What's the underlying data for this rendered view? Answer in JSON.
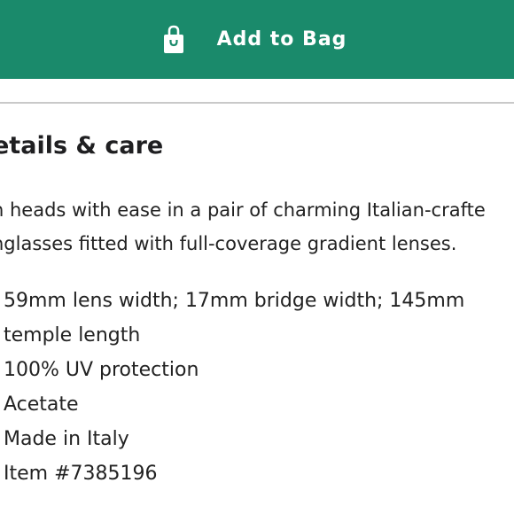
{
  "button": {
    "label": "Add to Bag",
    "icon": "shopping-bag-icon",
    "color": "#1a8a6b"
  },
  "details": {
    "heading": "etails & care",
    "description_lines": [
      "n heads with ease in a pair of charming Italian-crafte",
      "nglasses fitted with full-coverage gradient lenses."
    ],
    "specs": [
      "59mm lens width; 17mm bridge width; 145mm",
      "temple length",
      "100% UV protection",
      "Acetate",
      "Made in Italy",
      "Item #7385196"
    ]
  }
}
